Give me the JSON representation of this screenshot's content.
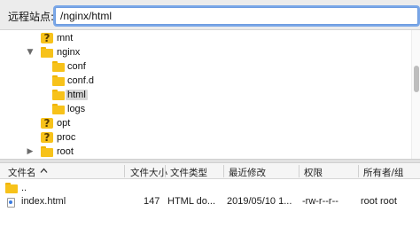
{
  "site_bar": {
    "label": "远程站点:",
    "path_value": "/nginx/html"
  },
  "tree": {
    "items": [
      {
        "name": "mnt",
        "icon": "unknown-folder-icon",
        "arrow": ""
      },
      {
        "name": "nginx",
        "icon": "folder-icon",
        "arrow": "▼"
      },
      {
        "name": "conf",
        "icon": "folder-icon",
        "arrow": ""
      },
      {
        "name": "conf.d",
        "icon": "folder-icon",
        "arrow": ""
      },
      {
        "name": "html",
        "icon": "folder-icon",
        "arrow": "",
        "selected": true
      },
      {
        "name": "logs",
        "icon": "folder-icon",
        "arrow": ""
      },
      {
        "name": "opt",
        "icon": "unknown-folder-icon",
        "arrow": ""
      },
      {
        "name": "proc",
        "icon": "unknown-folder-icon",
        "arrow": ""
      },
      {
        "name": "root",
        "icon": "folder-icon",
        "arrow": "▶"
      }
    ]
  },
  "file_list": {
    "columns": {
      "name": "文件名",
      "size": "文件大小",
      "type": "文件类型",
      "modified": "最近修改",
      "permissions": "权限",
      "owner": "所有者/组"
    },
    "rows": [
      {
        "name": "..",
        "size": "",
        "type": "",
        "modified": "",
        "permissions": "",
        "owner": "",
        "icon": "folder-icon"
      },
      {
        "name": "index.html",
        "size": "147",
        "type": "HTML do...",
        "modified": "2019/05/10 1...",
        "permissions": "-rw-r--r--",
        "owner": "root root",
        "icon": "html-file-icon"
      }
    ]
  }
}
